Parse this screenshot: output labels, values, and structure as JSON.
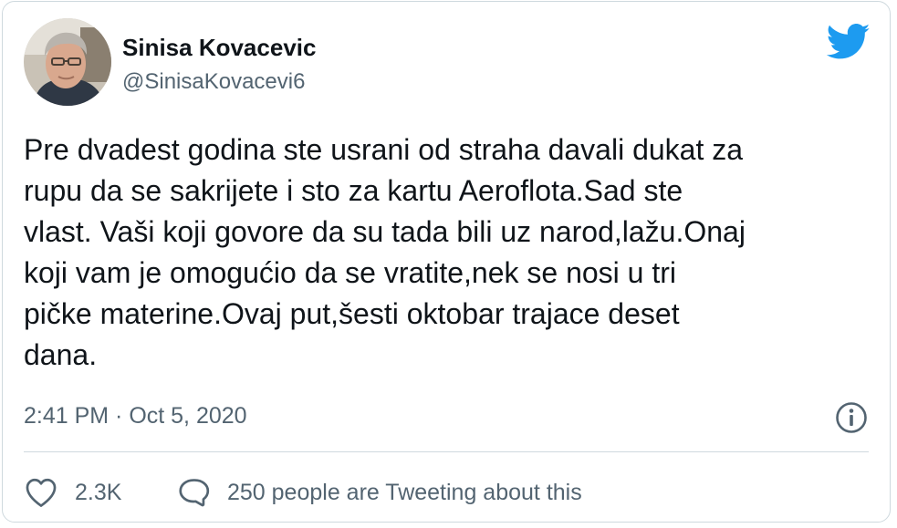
{
  "author": {
    "display_name": "Sinisa Kovacevic",
    "handle": "@SinisaKovacevi6",
    "avatar_icon": "profile-photo"
  },
  "brand": {
    "icon": "twitter-bird-icon",
    "color": "#1d9bf0"
  },
  "tweet": {
    "text": "Pre dvadest godina ste usrani od straha davali dukat za\nrupu da se sakrijete i sto za kartu Aeroflota.Sad ste\nvlast. Vaši koji govore da su tada bili uz narod,lažu.Onaj\nkoji vam je omogućio da se vratite,nek se nosi u tri\npičke materine.Ovaj put,šesti oktobar trajace deset\ndana.",
    "timestamp": "2:41 PM · Oct 5, 2020"
  },
  "actions": {
    "like_count": "2.3K",
    "conversation_label": "250 people are Tweeting about this"
  },
  "colors": {
    "text_primary": "#0f1419",
    "text_secondary": "#536471",
    "border": "#cfd9de"
  }
}
